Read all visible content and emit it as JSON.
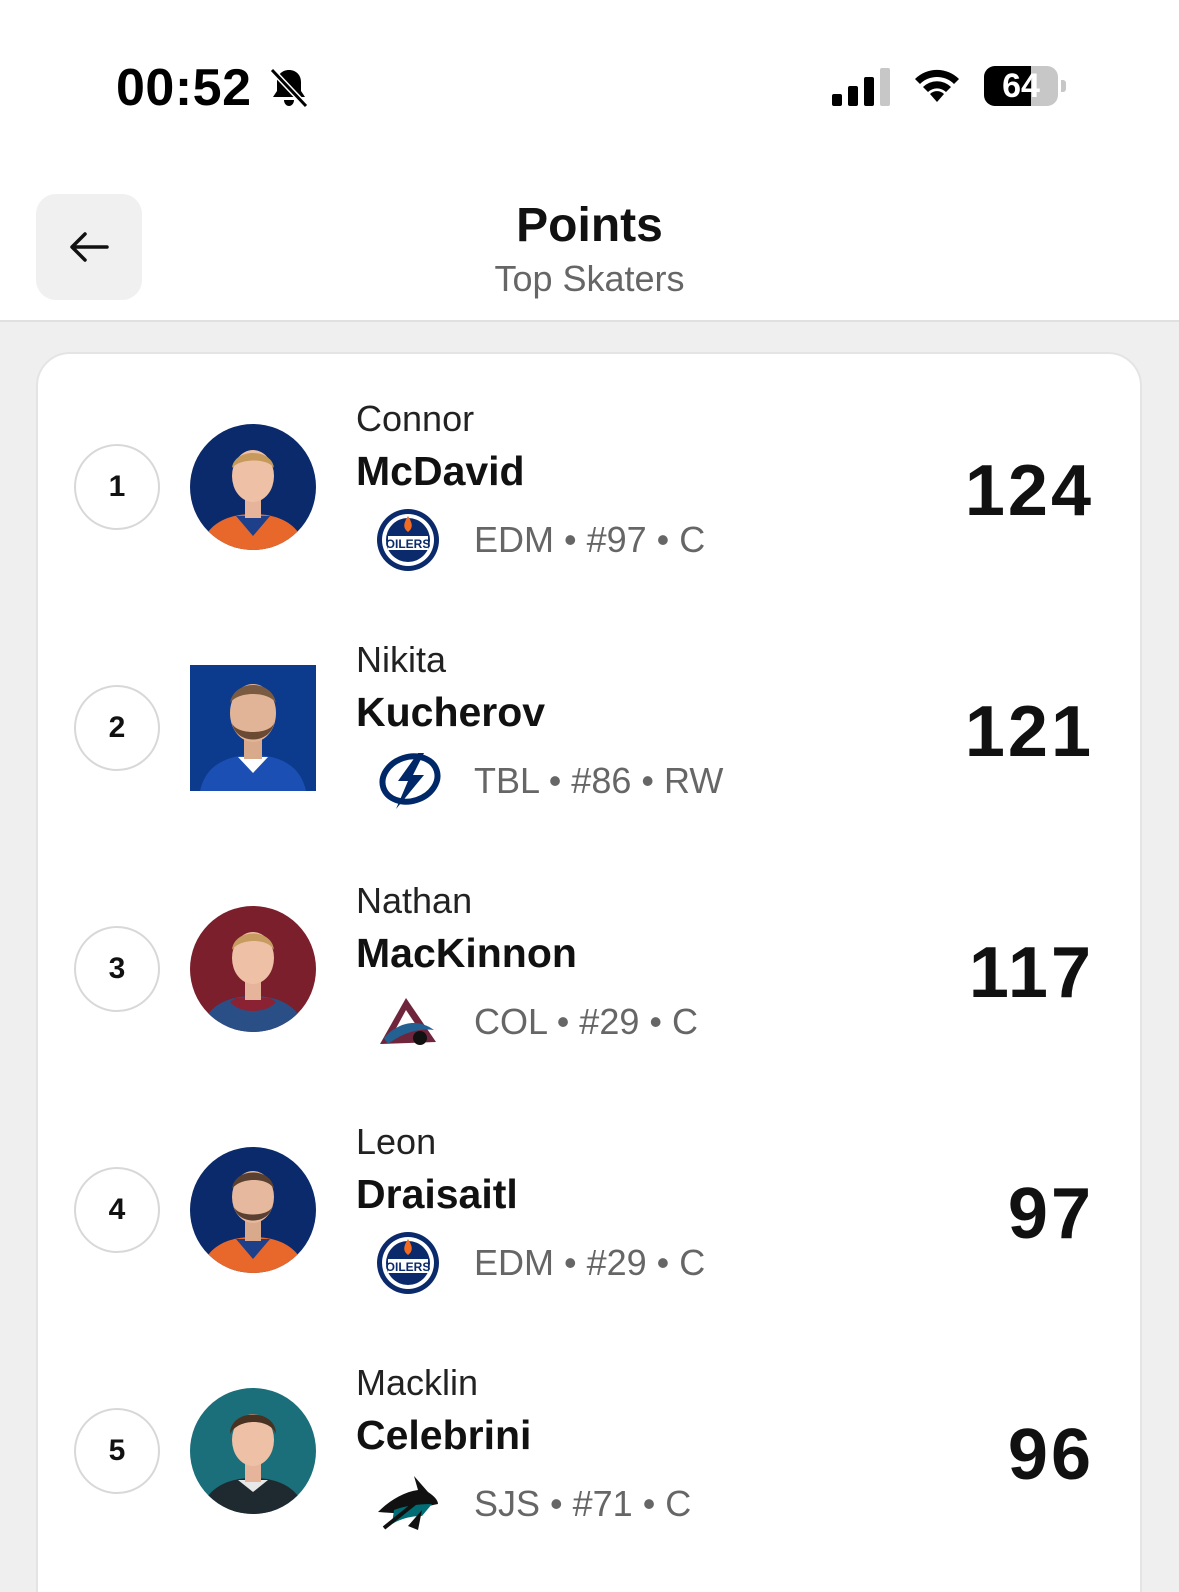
{
  "status_bar": {
    "time": "00:52",
    "battery": "64",
    "battery_level": 0.64
  },
  "header": {
    "title": "Points",
    "subtitle": "Top Skaters",
    "back_icon": "arrow-left-icon"
  },
  "players": [
    {
      "rank": "1",
      "first_name": "Connor",
      "last_name": "McDavid",
      "meta": "EDM • #97 • C",
      "points": "124",
      "team_logo": "oilers-logo",
      "jersey_color": "#e8672a",
      "bg_color": "#0b2a6b"
    },
    {
      "rank": "2",
      "first_name": "Nikita",
      "last_name": "Kucherov",
      "meta": "TBL • #86 • RW",
      "points": "121",
      "team_logo": "lightning-logo",
      "jersey_color": "#1b4fb3",
      "bg_color": "#0c3a8c"
    },
    {
      "rank": "3",
      "first_name": "Nathan",
      "last_name": "MacKinnon",
      "meta": "COL • #29 • C",
      "points": "117",
      "team_logo": "avalanche-logo",
      "jersey_color": "#2a4f86",
      "bg_color": "#7a1f2b"
    },
    {
      "rank": "4",
      "first_name": "Leon",
      "last_name": "Draisaitl",
      "meta": "EDM • #29 • C",
      "points": "97",
      "team_logo": "oilers-logo",
      "jersey_color": "#e8672a",
      "bg_color": "#0b2a6b"
    },
    {
      "rank": "5",
      "first_name": "Macklin",
      "last_name": "Celebrini",
      "meta": "SJS • #71 • C",
      "points": "96",
      "team_logo": "sharks-logo",
      "jersey_color": "#1f2a30",
      "bg_color": "#1b6f7a"
    }
  ]
}
